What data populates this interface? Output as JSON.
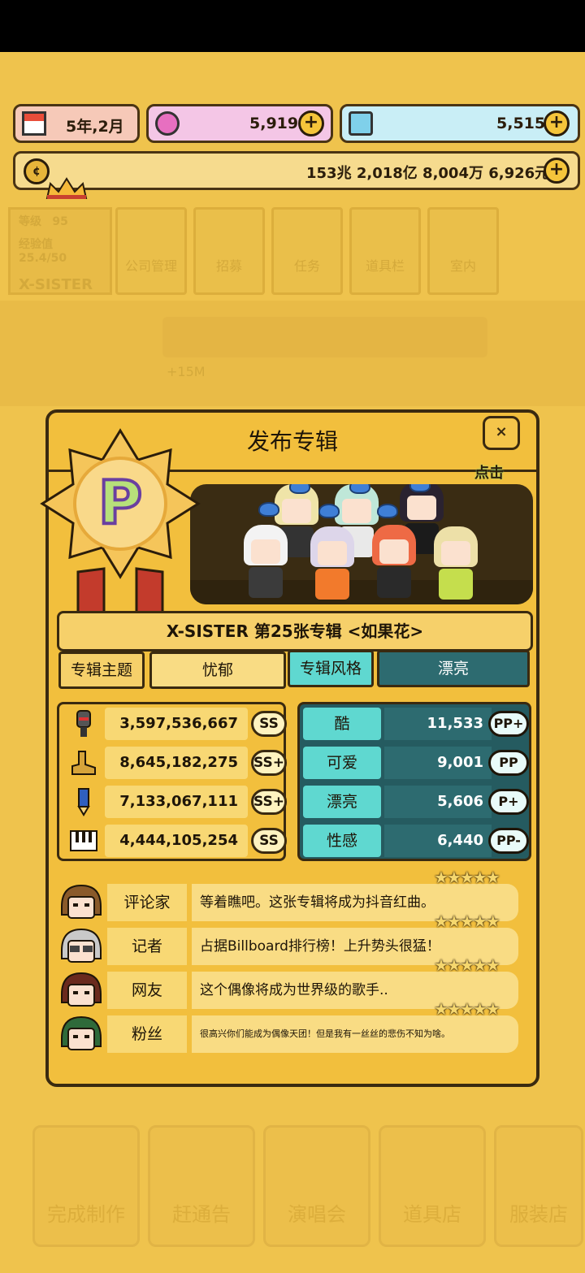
{
  "hud": {
    "date": "5年,2月",
    "pink_gems": "5,919",
    "blue_gems": "5,515",
    "money": "153兆 2,018亿 8,004万 6,926元",
    "plus": "+"
  },
  "background": {
    "level_label": "等级",
    "level_value": "95",
    "exp_label": "经验值",
    "exp_value": "25.4/50",
    "group_name": "X-SISTER",
    "top_tabs": [
      "公司管理",
      "招募",
      "任务",
      "道具栏",
      "室内"
    ],
    "bonus": "+15M",
    "bottom_buttons": [
      "完成制作",
      "赶通告",
      "演唱会",
      "道具店",
      "服装店"
    ]
  },
  "modal": {
    "title": "发布专辑",
    "close": "×",
    "tap_hint": "点击",
    "badge_letter": "P",
    "album_name": "X-SISTER 第25张专辑 <如果花>",
    "theme_label": "专辑主题",
    "theme_value": "忧郁",
    "style_label": "专辑风格",
    "style_value": "漂亮",
    "stats": [
      {
        "icon": "vocal-icon",
        "value": "3,597,536,667",
        "grade": "SS"
      },
      {
        "icon": "dance-icon",
        "value": "8,645,182,275",
        "grade": "SS+"
      },
      {
        "icon": "lyrics-icon",
        "value": "7,133,067,111",
        "grade": "SS+"
      },
      {
        "icon": "composition-icon",
        "value": "4,444,105,254",
        "grade": "SS"
      }
    ],
    "styles": [
      {
        "label": "酷",
        "value": "11,533",
        "grade": "PP+"
      },
      {
        "label": "可爱",
        "value": "9,001",
        "grade": "PP"
      },
      {
        "label": "漂亮",
        "value": "5,606",
        "grade": "P+"
      },
      {
        "label": "性感",
        "value": "6,440",
        "grade": "PP-"
      }
    ],
    "reviews": [
      {
        "who": "评论家",
        "text": "等着瞧吧。这张专辑将成为抖音红曲。",
        "stars": 5
      },
      {
        "who": "记者",
        "text": "占据Billboard排行榜！上升势头很猛！",
        "stars": 5
      },
      {
        "who": "网友",
        "text": "这个偶像将成为世界级的歌手..",
        "stars": 5
      },
      {
        "who": "粉丝",
        "text": "很高兴你们能成为偶像天团！但是我有一丝丝的悲伤不知为啥。",
        "stars": 5
      }
    ]
  },
  "colors": {
    "modal_bg": "#f2bf3d",
    "style_teal": "#5fd8d0",
    "style_dark": "#2d6b70",
    "outline": "#3a2a10"
  }
}
